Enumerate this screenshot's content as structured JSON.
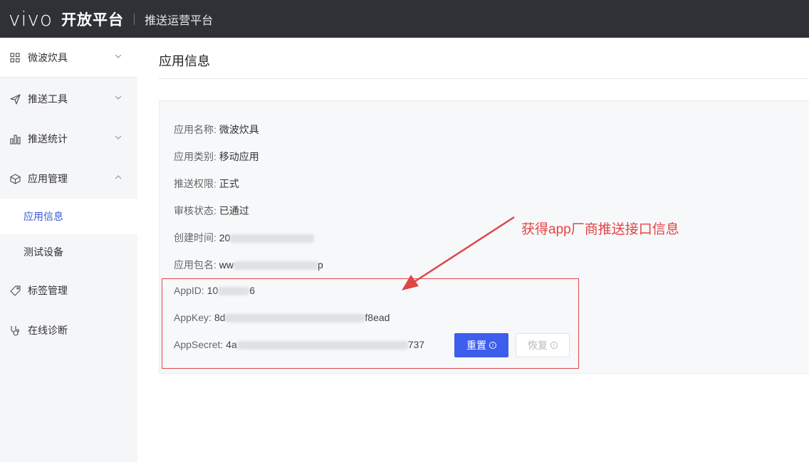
{
  "header": {
    "logo": "vivo",
    "open_platform": "开放平台",
    "subtitle": "推送运营平台"
  },
  "sidebar": {
    "items": [
      {
        "label": "微波炊具",
        "icon": "grid-icon",
        "expanded": false
      },
      {
        "label": "推送工具",
        "icon": "send-icon",
        "expanded": false
      },
      {
        "label": "推送统计",
        "icon": "bar-chart-icon",
        "expanded": false
      },
      {
        "label": "应用管理",
        "icon": "cube-icon",
        "expanded": true
      },
      {
        "label": "标签管理",
        "icon": "tag-icon"
      },
      {
        "label": "在线诊断",
        "icon": "stethoscope-icon"
      }
    ],
    "subitems": [
      {
        "label": "应用信息",
        "active": true
      },
      {
        "label": "测试设备",
        "active": false
      }
    ]
  },
  "main": {
    "title": "应用信息",
    "fields": [
      {
        "key": "应用名称:",
        "value": "微波炊具"
      },
      {
        "key": "应用类别:",
        "value": "移动应用"
      },
      {
        "key": "推送权限:",
        "value": "正式"
      },
      {
        "key": "审核状态:",
        "value": "已通过"
      },
      {
        "key": "创建时间:",
        "value_start": "20",
        "value_end": ""
      },
      {
        "key": "应用包名:",
        "value_start": "ww",
        "value_end": "p"
      }
    ],
    "keys": [
      {
        "key": "AppID:",
        "value_start": "10",
        "value_end": "6"
      },
      {
        "key": "AppKey:",
        "value_start": "8d",
        "value_end": "f8ead"
      },
      {
        "key": "AppSecret:",
        "value_start": "4a",
        "value_end": "737"
      }
    ],
    "buttons": {
      "reset": "重置",
      "restore": "恢复"
    }
  },
  "annotation": {
    "text": "获得app厂商推送接口信息",
    "color": "#e14545"
  },
  "colors": {
    "topbar": "#2f3136",
    "accent": "#3d5dec",
    "active_text": "#3a5bd9"
  }
}
